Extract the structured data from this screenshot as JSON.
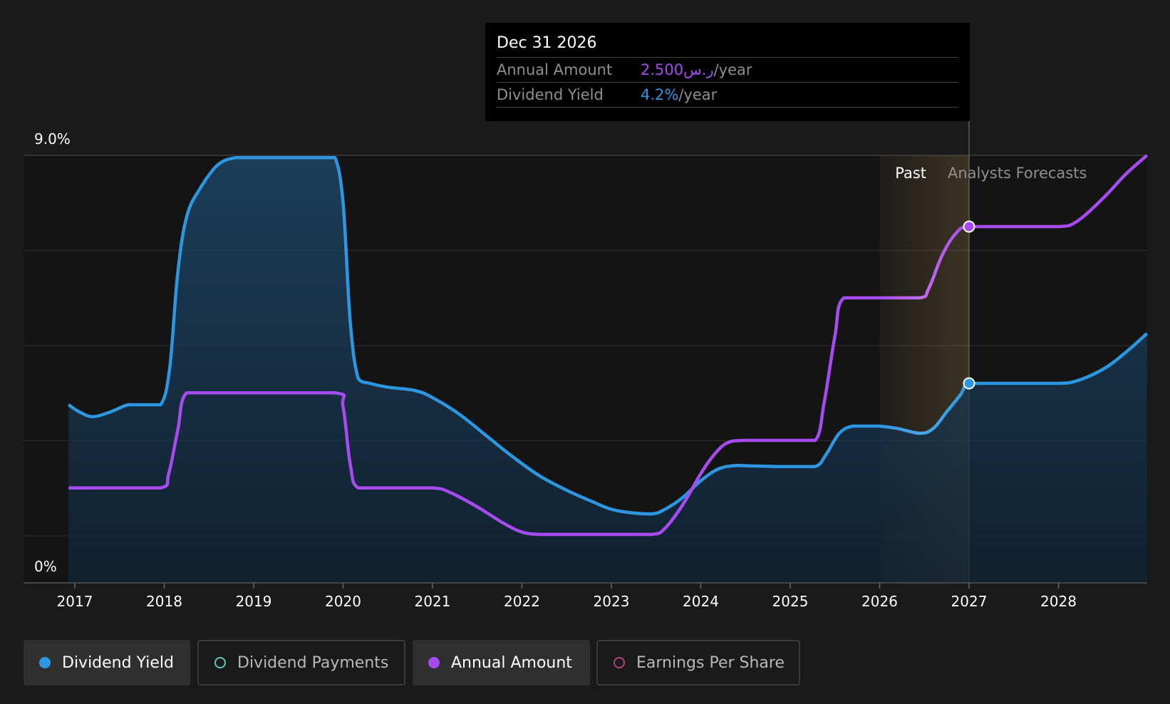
{
  "tooltip": {
    "date": "Dec 31 2026",
    "rows": [
      {
        "label": "Annual Amount",
        "value": "2.500ر.س",
        "unit": "/year"
      },
      {
        "label": "Dividend Yield",
        "value": "4.2%",
        "unit": "/year"
      }
    ]
  },
  "legend": [
    {
      "label": "Dividend Yield",
      "color": "#2d96e0",
      "active": true,
      "filled": true
    },
    {
      "label": "Dividend Payments",
      "color": "#5fc8bc",
      "active": false,
      "filled": false
    },
    {
      "label": "Annual Amount",
      "color": "#a64bf0",
      "active": true,
      "filled": true
    },
    {
      "label": "Earnings Per Share",
      "color": "#b0457f",
      "active": false,
      "filled": false
    }
  ],
  "colors": {
    "yield": "#2d96e0",
    "amount": "#a64bf0",
    "background": "#1a1a1a",
    "plot": "#141414",
    "past_band": "#c8a060"
  },
  "chart_data": {
    "type": "area",
    "x_tick_labels": [
      "2017",
      "2018",
      "2019",
      "2020",
      "2021",
      "2022",
      "2023",
      "2024",
      "2025",
      "2026",
      "2027",
      "2028"
    ],
    "y_tick_labels": [
      "9.0%",
      "0%"
    ],
    "ylim": [
      0,
      9.0
    ],
    "xlim": [
      2016.4,
      2028.99
    ],
    "grid": true,
    "region_labels": [
      "Past",
      "Analysts Forecasts"
    ],
    "past_end": 2027.0,
    "highlight": {
      "x": 2027.0,
      "dividend_yield": 4.2,
      "annual_amount_sar": 2.5
    },
    "series": [
      {
        "name": "Dividend Yield",
        "unit": "%",
        "points": [
          [
            2016.93,
            3.75
          ],
          [
            2017.05,
            3.6
          ],
          [
            2017.2,
            3.5
          ],
          [
            2017.4,
            3.6
          ],
          [
            2017.6,
            3.75
          ],
          [
            2017.8,
            3.75
          ],
          [
            2017.96,
            3.75
          ],
          [
            2018.06,
            4.5
          ],
          [
            2018.15,
            6.5
          ],
          [
            2018.25,
            7.7
          ],
          [
            2018.4,
            8.3
          ],
          [
            2018.6,
            8.8
          ],
          [
            2018.8,
            8.95
          ],
          [
            2019.0,
            8.95
          ],
          [
            2019.4,
            8.95
          ],
          [
            2019.8,
            8.95
          ],
          [
            2019.91,
            8.95
          ],
          [
            2020.0,
            8.0
          ],
          [
            2020.08,
            5.5
          ],
          [
            2020.17,
            4.3
          ],
          [
            2020.3,
            4.2
          ],
          [
            2020.5,
            4.12
          ],
          [
            2020.8,
            4.05
          ],
          [
            2021.0,
            3.9
          ],
          [
            2021.3,
            3.55
          ],
          [
            2021.6,
            3.1
          ],
          [
            2021.9,
            2.65
          ],
          [
            2022.2,
            2.25
          ],
          [
            2022.5,
            1.95
          ],
          [
            2022.8,
            1.7
          ],
          [
            2023.0,
            1.55
          ],
          [
            2023.2,
            1.48
          ],
          [
            2023.45,
            1.45
          ],
          [
            2023.6,
            1.55
          ],
          [
            2023.8,
            1.8
          ],
          [
            2024.0,
            2.15
          ],
          [
            2024.2,
            2.4
          ],
          [
            2024.4,
            2.47
          ],
          [
            2024.6,
            2.46
          ],
          [
            2024.85,
            2.45
          ],
          [
            2025.0,
            2.45
          ],
          [
            2025.28,
            2.45
          ],
          [
            2025.4,
            2.7
          ],
          [
            2025.55,
            3.15
          ],
          [
            2025.7,
            3.3
          ],
          [
            2025.9,
            3.3
          ],
          [
            2026.0,
            3.3
          ],
          [
            2026.2,
            3.25
          ],
          [
            2026.45,
            3.15
          ],
          [
            2026.6,
            3.25
          ],
          [
            2026.75,
            3.6
          ],
          [
            2026.9,
            3.95
          ],
          [
            2027.0,
            4.2
          ],
          [
            2027.3,
            4.2
          ],
          [
            2027.6,
            4.2
          ],
          [
            2028.0,
            4.2
          ],
          [
            2028.2,
            4.25
          ],
          [
            2028.5,
            4.5
          ],
          [
            2028.75,
            4.85
          ],
          [
            2028.99,
            5.25
          ]
        ]
      },
      {
        "name": "Annual Amount",
        "unit": "SAR/year",
        "points": [
          [
            2016.93,
            2.0
          ],
          [
            2017.4,
            2.0
          ],
          [
            2017.96,
            2.0
          ],
          [
            2018.05,
            2.3
          ],
          [
            2018.15,
            3.2
          ],
          [
            2018.25,
            4.0
          ],
          [
            2018.6,
            4.0
          ],
          [
            2019.0,
            4.0
          ],
          [
            2019.91,
            4.0
          ],
          [
            2020.0,
            3.7
          ],
          [
            2020.08,
            2.5
          ],
          [
            2020.17,
            2.0
          ],
          [
            2020.5,
            2.0
          ],
          [
            2021.0,
            2.0
          ],
          [
            2021.2,
            1.9
          ],
          [
            2021.5,
            1.6
          ],
          [
            2021.8,
            1.25
          ],
          [
            2022.0,
            1.07
          ],
          [
            2022.2,
            1.02
          ],
          [
            2022.5,
            1.02
          ],
          [
            2023.0,
            1.02
          ],
          [
            2023.45,
            1.02
          ],
          [
            2023.6,
            1.15
          ],
          [
            2023.8,
            1.65
          ],
          [
            2024.0,
            2.3
          ],
          [
            2024.15,
            2.7
          ],
          [
            2024.3,
            2.95
          ],
          [
            2024.5,
            3.0
          ],
          [
            2025.0,
            3.0
          ],
          [
            2025.28,
            3.0
          ],
          [
            2025.38,
            3.8
          ],
          [
            2025.5,
            5.2
          ],
          [
            2025.6,
            6.0
          ],
          [
            2026.0,
            6.0
          ],
          [
            2026.45,
            6.0
          ],
          [
            2026.55,
            6.2
          ],
          [
            2026.7,
            6.9
          ],
          [
            2026.85,
            7.35
          ],
          [
            2027.0,
            7.5
          ],
          [
            2027.5,
            7.5
          ],
          [
            2028.0,
            7.5
          ],
          [
            2028.2,
            7.6
          ],
          [
            2028.5,
            8.1
          ],
          [
            2028.75,
            8.6
          ],
          [
            2028.99,
            9.0
          ]
        ]
      }
    ]
  }
}
